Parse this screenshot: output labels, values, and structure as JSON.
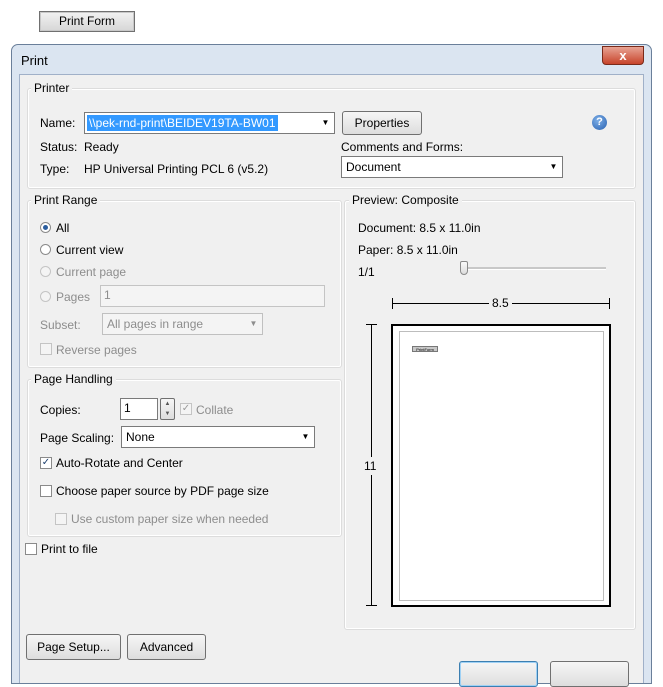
{
  "top": {
    "print_form_label": "Print Form"
  },
  "dialog": {
    "title": "Print",
    "close_glyph": "x",
    "printer": {
      "group_title": "Printer",
      "name_label": "Name:",
      "name_value": "\\\\pek-rnd-print\\BEIDEV19TA-BW01",
      "properties_label": "Properties",
      "status_label": "Status:",
      "status_value": "Ready",
      "type_label": "Type:",
      "type_value": "HP Universal Printing PCL 6 (v5.2)",
      "comments_label": "Comments and Forms:",
      "comments_value": "Document",
      "help_glyph": "?"
    },
    "print_range": {
      "group_title": "Print Range",
      "all_label": "All",
      "current_view_label": "Current view",
      "current_page_label": "Current page",
      "pages_label": "Pages",
      "pages_value": "1",
      "subset_label": "Subset:",
      "subset_value": "All pages in range",
      "reverse_label": "Reverse pages"
    },
    "page_handling": {
      "group_title": "Page Handling",
      "copies_label": "Copies:",
      "copies_value": "1",
      "collate_label": "Collate",
      "scaling_label": "Page Scaling:",
      "scaling_value": "None",
      "auto_rotate_label": "Auto-Rotate and Center",
      "paper_source_label": "Choose paper source by PDF page size",
      "custom_paper_label": "Use custom paper size when needed"
    },
    "print_to_file_label": "Print to file",
    "preview": {
      "group_title": "Preview: Composite",
      "document_text": "Document: 8.5 x 11.0in",
      "paper_text": "Paper: 8.5 x 11.0in",
      "page_counter": "1/1",
      "width_label": "8.5",
      "height_label": "11",
      "mini_button_text": "PrintForm"
    },
    "buttons": {
      "page_setup_label": "Page Setup...",
      "advanced_label": "Advanced"
    },
    "colors": {
      "accent": "#3399ff",
      "title_bar": "#dbe5f1",
      "close": "#c7442b"
    }
  }
}
